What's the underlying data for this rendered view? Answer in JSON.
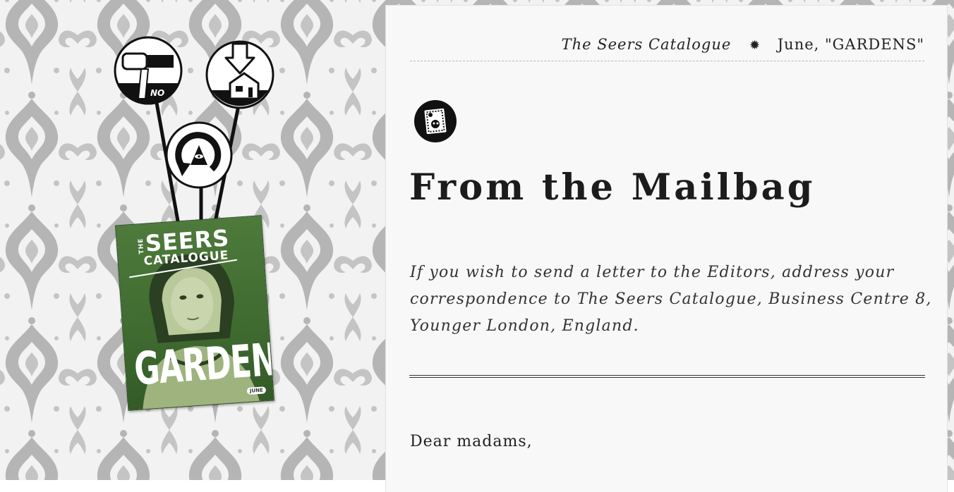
{
  "header": {
    "publication": "The Seers Catalogue",
    "separator": "✹",
    "issue": "June, \"GARDENS\""
  },
  "article": {
    "title": "From the Mailbag",
    "intro": "If you wish to send a letter to the Editors, address your correspondence to The Seers Catalogue, Business Centre 8, Younger London, England.",
    "greeting": "Dear madams,"
  },
  "cover": {
    "the": "THE",
    "seers": "SEERS",
    "catalogue": "CATALOGUE",
    "issue_title": "GARDENS",
    "month": "JUNE"
  },
  "balloons": {
    "no_label": "NO"
  },
  "colors": {
    "panel_bg": "#f8f8f8",
    "text": "#1c1c1c",
    "cover_green": "#4e7a3c",
    "wallpaper_pattern": "#b3b3b3"
  },
  "icons": [
    "hand-knife-no-icon",
    "arrow-to-house-icon",
    "eye-pyramid-cycle-icon",
    "stamp-icon"
  ]
}
